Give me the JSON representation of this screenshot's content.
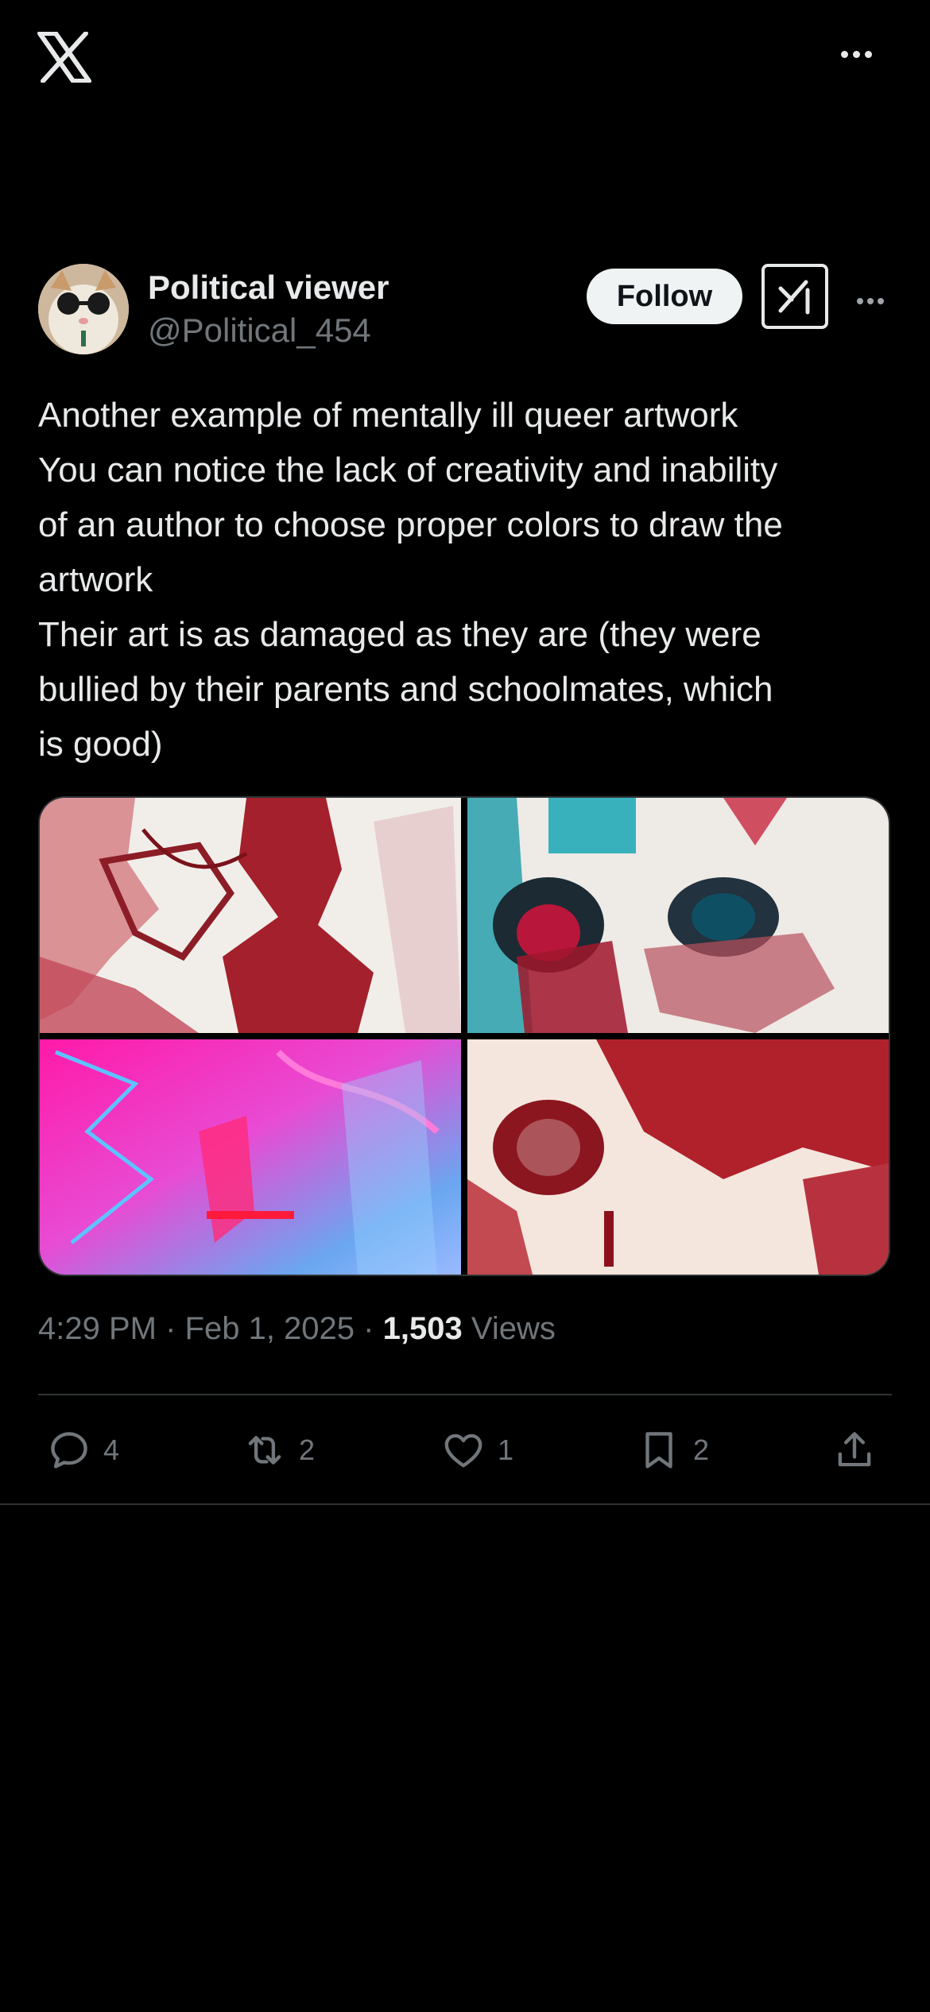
{
  "topbar": {
    "logo_icon": "x-logo-icon",
    "more_icon": "more-horizontal-icon"
  },
  "author": {
    "display_name": "Political viewer",
    "handle": "@Political_454",
    "avatar_icon": "avatar-cat-sunglasses"
  },
  "header_actions": {
    "follow_label": "Follow",
    "grok_icon": "grok-icon",
    "more_icon": "more-horizontal-icon"
  },
  "tweet": {
    "lines": [
      "Another example of mentally ill queer artwork",
      "You can notice the lack of creativity and inability",
      "of an author to choose proper colors to draw the",
      "artwork",
      "Their art is as damaged as they are (they were",
      "bullied by their parents and schoolmates, which",
      "is good)"
    ]
  },
  "media": {
    "images": [
      {
        "name": "artwork-red-ink-1"
      },
      {
        "name": "artwork-eyes-teal-red"
      },
      {
        "name": "artwork-pink-blue-digital"
      },
      {
        "name": "artwork-red-face-closeup"
      }
    ]
  },
  "meta": {
    "time": "4:29 PM",
    "separator": "·",
    "date": "Feb 1, 2025",
    "views_count": "1,503",
    "views_label": "Views"
  },
  "actions": {
    "replies": "4",
    "reposts": "2",
    "likes": "1",
    "bookmarks": "2"
  },
  "colors": {
    "background": "#000000",
    "text": "#e7e9ea",
    "muted": "#71767b",
    "divider": "#2f3336"
  }
}
